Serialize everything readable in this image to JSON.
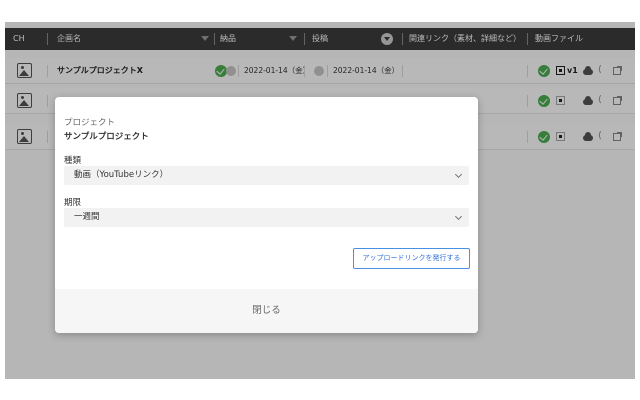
{
  "table": {
    "headers": {
      "ch": "CH",
      "project": "企画名",
      "delivery": "納品",
      "post": "投稿",
      "links": "関連リンク（素材、詳細など）",
      "video": "動画ファイル"
    },
    "rows": [
      {
        "title": "サンプルプロジェクトX",
        "delivery_date": "2022-01-14（金）",
        "post_date": "2022-01-14（金）",
        "version": "v1"
      }
    ]
  },
  "modal": {
    "subtitle": "プロジェクト",
    "project_name": "サンプルプロジェクト",
    "type_label": "種類",
    "type_value": "動画（YouTubeリンク）",
    "deadline_label": "期限",
    "deadline_value": "一週間",
    "issue_button": "アップロードリンクを発行する",
    "close_button": "閉じる"
  },
  "colors": {
    "header_bg": "#3c3c3c",
    "success": "#4caf50",
    "accent": "#4a90e2"
  }
}
